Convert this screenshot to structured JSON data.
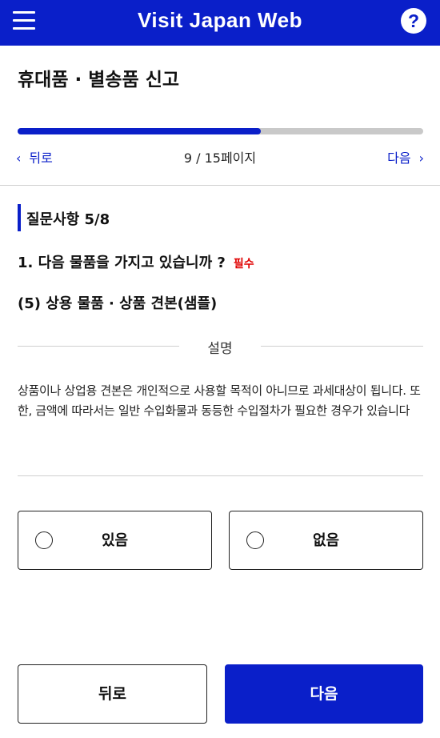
{
  "header": {
    "title": "Visit Japan Web",
    "help_symbol": "?",
    "menu_icon": "hamburger-icon",
    "help_icon": "question-circle-icon",
    "brand_color": "#0a1fc9"
  },
  "page": {
    "title": "휴대품 · 별송품 신고"
  },
  "progress": {
    "current_page": 9,
    "total_pages": 15,
    "fraction": 0.6,
    "counter_text": "9 / 15페이지"
  },
  "nav": {
    "back_label": "뒤로",
    "next_label": "다음",
    "back_chevron": "‹",
    "next_chevron": "›"
  },
  "section": {
    "label": "질문사항 5/8"
  },
  "question": {
    "text": "1. 다음 물품을 가지고 있습니까 ?",
    "required_label": "필수",
    "required_color": "#e00000",
    "subquestion": "(5) 상용 물품 · 상품 견본(샘플)"
  },
  "description": {
    "title": "설명",
    "text": "상품이나 상업용 견본은 개인적으로 사용할 목적이 아니므로 과세대상이 됩니다. 또한, 금액에 따라서는 일반 수입화물과 동등한 수입절차가 필요한 경우가 있습니다"
  },
  "options": {
    "yes_label": "있음",
    "no_label": "없음",
    "selected": null
  },
  "footer": {
    "back_label": "뒤로",
    "next_label": "다음"
  }
}
